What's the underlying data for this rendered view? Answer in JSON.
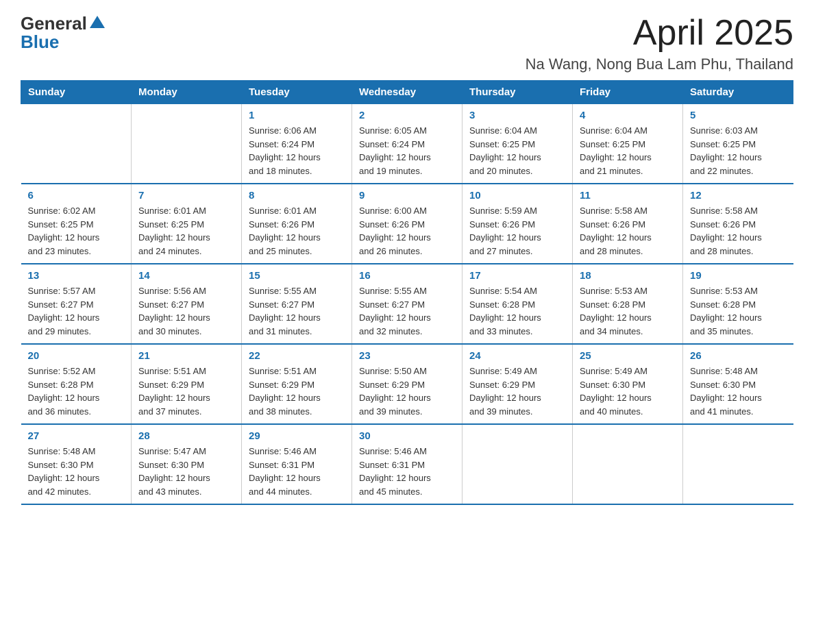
{
  "logo": {
    "text_general": "General",
    "triangle": "▲",
    "text_blue": "Blue"
  },
  "title": "April 2025",
  "subtitle": "Na Wang, Nong Bua Lam Phu, Thailand",
  "days_of_week": [
    "Sunday",
    "Monday",
    "Tuesday",
    "Wednesday",
    "Thursday",
    "Friday",
    "Saturday"
  ],
  "weeks": [
    [
      {
        "day": "",
        "info": ""
      },
      {
        "day": "",
        "info": ""
      },
      {
        "day": "1",
        "info": "Sunrise: 6:06 AM\nSunset: 6:24 PM\nDaylight: 12 hours\nand 18 minutes."
      },
      {
        "day": "2",
        "info": "Sunrise: 6:05 AM\nSunset: 6:24 PM\nDaylight: 12 hours\nand 19 minutes."
      },
      {
        "day": "3",
        "info": "Sunrise: 6:04 AM\nSunset: 6:25 PM\nDaylight: 12 hours\nand 20 minutes."
      },
      {
        "day": "4",
        "info": "Sunrise: 6:04 AM\nSunset: 6:25 PM\nDaylight: 12 hours\nand 21 minutes."
      },
      {
        "day": "5",
        "info": "Sunrise: 6:03 AM\nSunset: 6:25 PM\nDaylight: 12 hours\nand 22 minutes."
      }
    ],
    [
      {
        "day": "6",
        "info": "Sunrise: 6:02 AM\nSunset: 6:25 PM\nDaylight: 12 hours\nand 23 minutes."
      },
      {
        "day": "7",
        "info": "Sunrise: 6:01 AM\nSunset: 6:25 PM\nDaylight: 12 hours\nand 24 minutes."
      },
      {
        "day": "8",
        "info": "Sunrise: 6:01 AM\nSunset: 6:26 PM\nDaylight: 12 hours\nand 25 minutes."
      },
      {
        "day": "9",
        "info": "Sunrise: 6:00 AM\nSunset: 6:26 PM\nDaylight: 12 hours\nand 26 minutes."
      },
      {
        "day": "10",
        "info": "Sunrise: 5:59 AM\nSunset: 6:26 PM\nDaylight: 12 hours\nand 27 minutes."
      },
      {
        "day": "11",
        "info": "Sunrise: 5:58 AM\nSunset: 6:26 PM\nDaylight: 12 hours\nand 28 minutes."
      },
      {
        "day": "12",
        "info": "Sunrise: 5:58 AM\nSunset: 6:26 PM\nDaylight: 12 hours\nand 28 minutes."
      }
    ],
    [
      {
        "day": "13",
        "info": "Sunrise: 5:57 AM\nSunset: 6:27 PM\nDaylight: 12 hours\nand 29 minutes."
      },
      {
        "day": "14",
        "info": "Sunrise: 5:56 AM\nSunset: 6:27 PM\nDaylight: 12 hours\nand 30 minutes."
      },
      {
        "day": "15",
        "info": "Sunrise: 5:55 AM\nSunset: 6:27 PM\nDaylight: 12 hours\nand 31 minutes."
      },
      {
        "day": "16",
        "info": "Sunrise: 5:55 AM\nSunset: 6:27 PM\nDaylight: 12 hours\nand 32 minutes."
      },
      {
        "day": "17",
        "info": "Sunrise: 5:54 AM\nSunset: 6:28 PM\nDaylight: 12 hours\nand 33 minutes."
      },
      {
        "day": "18",
        "info": "Sunrise: 5:53 AM\nSunset: 6:28 PM\nDaylight: 12 hours\nand 34 minutes."
      },
      {
        "day": "19",
        "info": "Sunrise: 5:53 AM\nSunset: 6:28 PM\nDaylight: 12 hours\nand 35 minutes."
      }
    ],
    [
      {
        "day": "20",
        "info": "Sunrise: 5:52 AM\nSunset: 6:28 PM\nDaylight: 12 hours\nand 36 minutes."
      },
      {
        "day": "21",
        "info": "Sunrise: 5:51 AM\nSunset: 6:29 PM\nDaylight: 12 hours\nand 37 minutes."
      },
      {
        "day": "22",
        "info": "Sunrise: 5:51 AM\nSunset: 6:29 PM\nDaylight: 12 hours\nand 38 minutes."
      },
      {
        "day": "23",
        "info": "Sunrise: 5:50 AM\nSunset: 6:29 PM\nDaylight: 12 hours\nand 39 minutes."
      },
      {
        "day": "24",
        "info": "Sunrise: 5:49 AM\nSunset: 6:29 PM\nDaylight: 12 hours\nand 39 minutes."
      },
      {
        "day": "25",
        "info": "Sunrise: 5:49 AM\nSunset: 6:30 PM\nDaylight: 12 hours\nand 40 minutes."
      },
      {
        "day": "26",
        "info": "Sunrise: 5:48 AM\nSunset: 6:30 PM\nDaylight: 12 hours\nand 41 minutes."
      }
    ],
    [
      {
        "day": "27",
        "info": "Sunrise: 5:48 AM\nSunset: 6:30 PM\nDaylight: 12 hours\nand 42 minutes."
      },
      {
        "day": "28",
        "info": "Sunrise: 5:47 AM\nSunset: 6:30 PM\nDaylight: 12 hours\nand 43 minutes."
      },
      {
        "day": "29",
        "info": "Sunrise: 5:46 AM\nSunset: 6:31 PM\nDaylight: 12 hours\nand 44 minutes."
      },
      {
        "day": "30",
        "info": "Sunrise: 5:46 AM\nSunset: 6:31 PM\nDaylight: 12 hours\nand 45 minutes."
      },
      {
        "day": "",
        "info": ""
      },
      {
        "day": "",
        "info": ""
      },
      {
        "day": "",
        "info": ""
      }
    ]
  ]
}
